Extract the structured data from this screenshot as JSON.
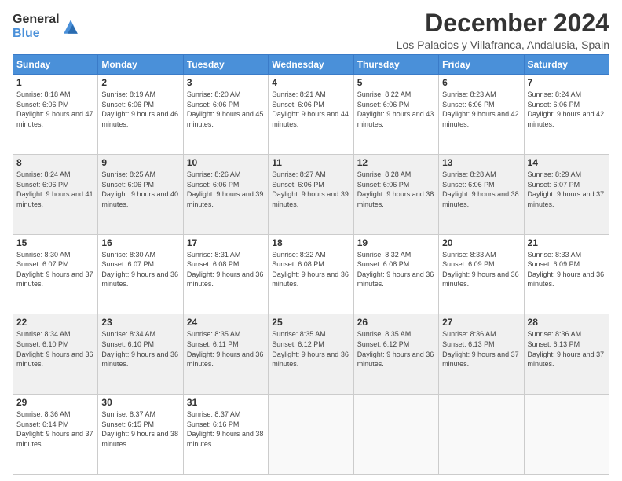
{
  "header": {
    "logo_general": "General",
    "logo_blue": "Blue",
    "title": "December 2024",
    "location": "Los Palacios y Villafranca, Andalusia, Spain"
  },
  "days_of_week": [
    "Sunday",
    "Monday",
    "Tuesday",
    "Wednesday",
    "Thursday",
    "Friday",
    "Saturday"
  ],
  "weeks": [
    [
      {
        "day": "1",
        "sunrise": "8:18 AM",
        "sunset": "6:06 PM",
        "daylight": "9 hours and 47 minutes."
      },
      {
        "day": "2",
        "sunrise": "8:19 AM",
        "sunset": "6:06 PM",
        "daylight": "9 hours and 46 minutes."
      },
      {
        "day": "3",
        "sunrise": "8:20 AM",
        "sunset": "6:06 PM",
        "daylight": "9 hours and 45 minutes."
      },
      {
        "day": "4",
        "sunrise": "8:21 AM",
        "sunset": "6:06 PM",
        "daylight": "9 hours and 44 minutes."
      },
      {
        "day": "5",
        "sunrise": "8:22 AM",
        "sunset": "6:06 PM",
        "daylight": "9 hours and 43 minutes."
      },
      {
        "day": "6",
        "sunrise": "8:23 AM",
        "sunset": "6:06 PM",
        "daylight": "9 hours and 42 minutes."
      },
      {
        "day": "7",
        "sunrise": "8:24 AM",
        "sunset": "6:06 PM",
        "daylight": "9 hours and 42 minutes."
      }
    ],
    [
      {
        "day": "8",
        "sunrise": "8:24 AM",
        "sunset": "6:06 PM",
        "daylight": "9 hours and 41 minutes."
      },
      {
        "day": "9",
        "sunrise": "8:25 AM",
        "sunset": "6:06 PM",
        "daylight": "9 hours and 40 minutes."
      },
      {
        "day": "10",
        "sunrise": "8:26 AM",
        "sunset": "6:06 PM",
        "daylight": "9 hours and 39 minutes."
      },
      {
        "day": "11",
        "sunrise": "8:27 AM",
        "sunset": "6:06 PM",
        "daylight": "9 hours and 39 minutes."
      },
      {
        "day": "12",
        "sunrise": "8:28 AM",
        "sunset": "6:06 PM",
        "daylight": "9 hours and 38 minutes."
      },
      {
        "day": "13",
        "sunrise": "8:28 AM",
        "sunset": "6:06 PM",
        "daylight": "9 hours and 38 minutes."
      },
      {
        "day": "14",
        "sunrise": "8:29 AM",
        "sunset": "6:07 PM",
        "daylight": "9 hours and 37 minutes."
      }
    ],
    [
      {
        "day": "15",
        "sunrise": "8:30 AM",
        "sunset": "6:07 PM",
        "daylight": "9 hours and 37 minutes."
      },
      {
        "day": "16",
        "sunrise": "8:30 AM",
        "sunset": "6:07 PM",
        "daylight": "9 hours and 36 minutes."
      },
      {
        "day": "17",
        "sunrise": "8:31 AM",
        "sunset": "6:08 PM",
        "daylight": "9 hours and 36 minutes."
      },
      {
        "day": "18",
        "sunrise": "8:32 AM",
        "sunset": "6:08 PM",
        "daylight": "9 hours and 36 minutes."
      },
      {
        "day": "19",
        "sunrise": "8:32 AM",
        "sunset": "6:08 PM",
        "daylight": "9 hours and 36 minutes."
      },
      {
        "day": "20",
        "sunrise": "8:33 AM",
        "sunset": "6:09 PM",
        "daylight": "9 hours and 36 minutes."
      },
      {
        "day": "21",
        "sunrise": "8:33 AM",
        "sunset": "6:09 PM",
        "daylight": "9 hours and 36 minutes."
      }
    ],
    [
      {
        "day": "22",
        "sunrise": "8:34 AM",
        "sunset": "6:10 PM",
        "daylight": "9 hours and 36 minutes."
      },
      {
        "day": "23",
        "sunrise": "8:34 AM",
        "sunset": "6:10 PM",
        "daylight": "9 hours and 36 minutes."
      },
      {
        "day": "24",
        "sunrise": "8:35 AM",
        "sunset": "6:11 PM",
        "daylight": "9 hours and 36 minutes."
      },
      {
        "day": "25",
        "sunrise": "8:35 AM",
        "sunset": "6:12 PM",
        "daylight": "9 hours and 36 minutes."
      },
      {
        "day": "26",
        "sunrise": "8:35 AM",
        "sunset": "6:12 PM",
        "daylight": "9 hours and 36 minutes."
      },
      {
        "day": "27",
        "sunrise": "8:36 AM",
        "sunset": "6:13 PM",
        "daylight": "9 hours and 37 minutes."
      },
      {
        "day": "28",
        "sunrise": "8:36 AM",
        "sunset": "6:13 PM",
        "daylight": "9 hours and 37 minutes."
      }
    ],
    [
      {
        "day": "29",
        "sunrise": "8:36 AM",
        "sunset": "6:14 PM",
        "daylight": "9 hours and 37 minutes."
      },
      {
        "day": "30",
        "sunrise": "8:37 AM",
        "sunset": "6:15 PM",
        "daylight": "9 hours and 38 minutes."
      },
      {
        "day": "31",
        "sunrise": "8:37 AM",
        "sunset": "6:16 PM",
        "daylight": "9 hours and 38 minutes."
      },
      null,
      null,
      null,
      null
    ]
  ]
}
